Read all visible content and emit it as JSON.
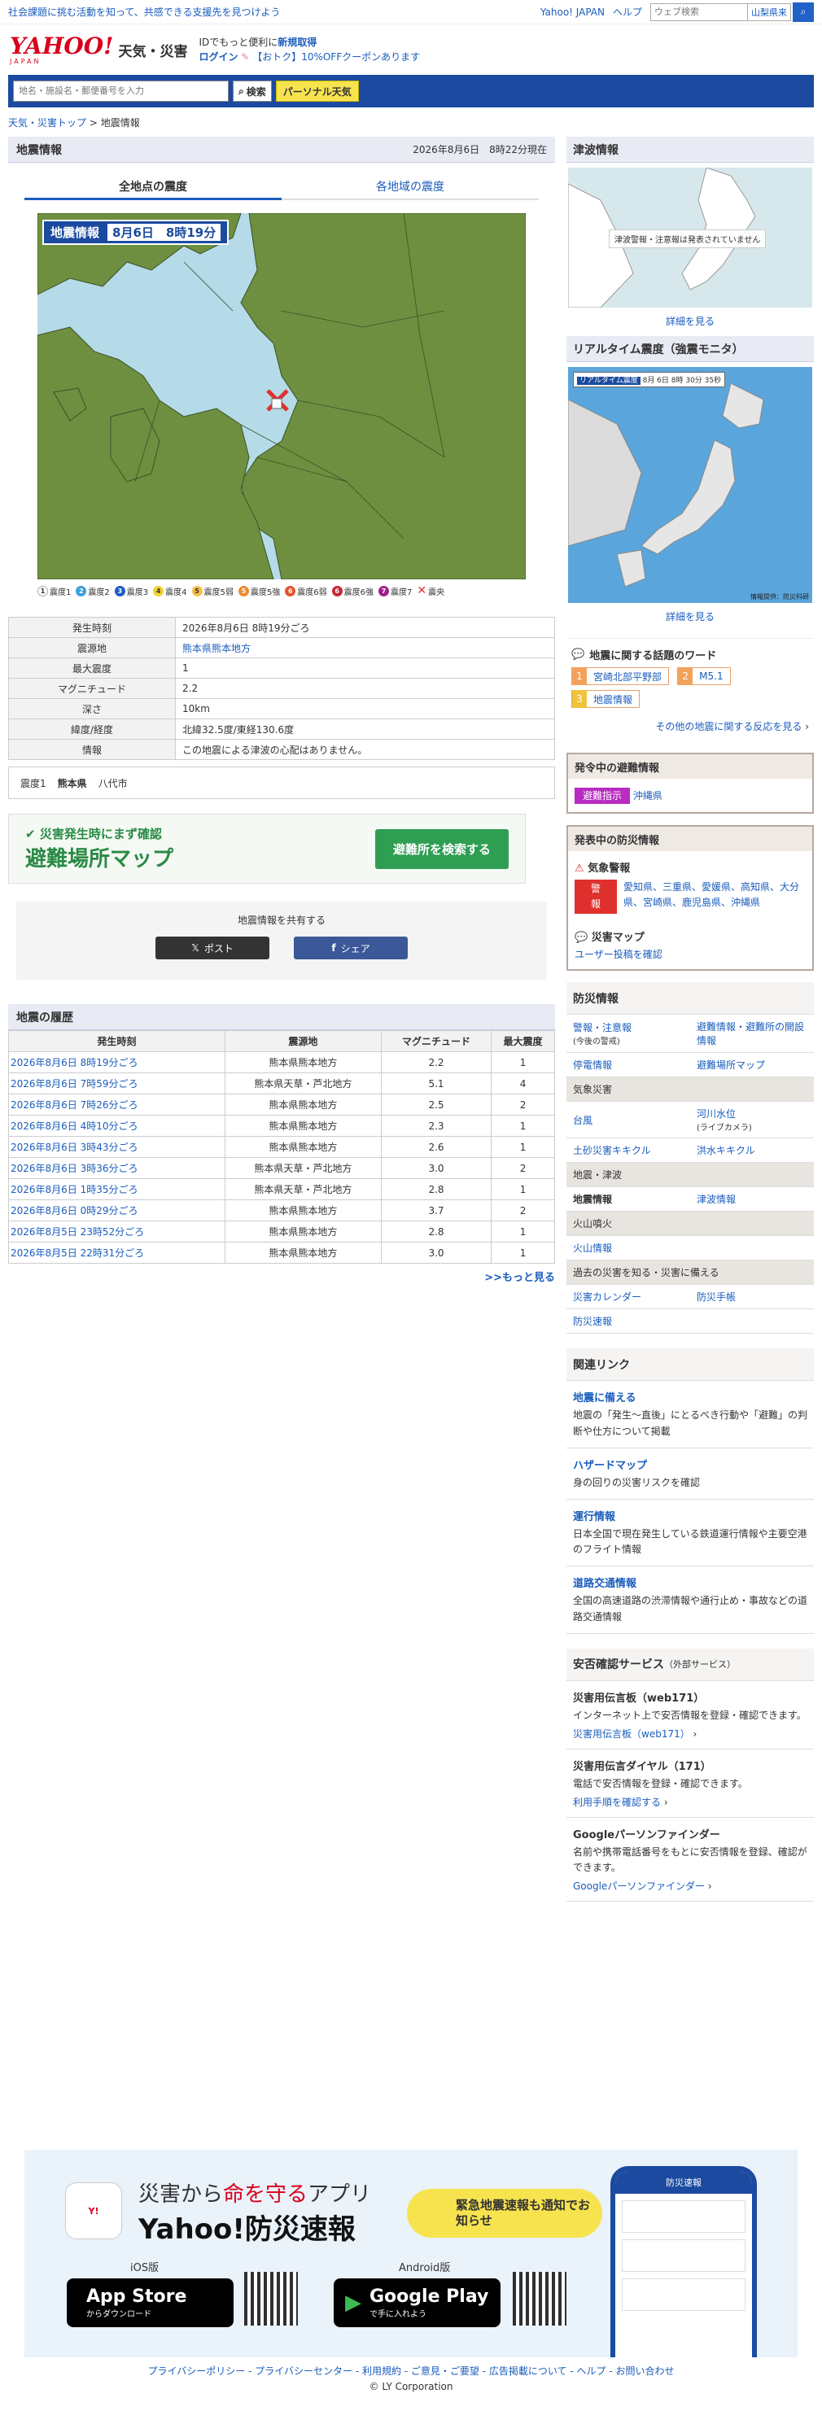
{
  "topbar": {
    "promo": "社会課題に挑む活動を知って、共感できる支援先を見つけよう",
    "links": [
      "Yahoo! JAPAN",
      "ヘルプ"
    ],
    "search_placeholder": "ウェブ検索",
    "location": "山梨県来"
  },
  "header": {
    "logo": "YAHOO!",
    "logo_sub": "JAPAN",
    "service": "天気・災害",
    "msg1": "IDでもっと便利に",
    "msg1_link": "新規取得",
    "login": "ログイン",
    "coupon": "【おトク】10%OFFクーポンあります"
  },
  "search": {
    "placeholder": "地名・施設名・郵便番号を入力",
    "button": "検索",
    "personal": "パーソナル天気"
  },
  "breadcrumb": [
    "天気・災害トップ",
    "地震情報"
  ],
  "quake": {
    "title": "地震情報",
    "asof": "2026年8月6日　8時22分現在",
    "tabs": [
      "全地点の震度",
      "各地域の震度"
    ],
    "map_title": "地震情報",
    "map_date": "8月6日　8時19分",
    "legend": [
      "震度1",
      "震度2",
      "震度3",
      "震度4",
      "震度5弱",
      "震度5強",
      "震度6弱",
      "震度6強",
      "震度7",
      "震央"
    ],
    "rows": [
      [
        "発生時刻",
        "2026年8月6日 8時19分ごろ"
      ],
      [
        "震源地",
        "熊本県熊本地方"
      ],
      [
        "最大震度",
        "1"
      ],
      [
        "マグニチュード",
        "2.2"
      ],
      [
        "深さ",
        "10km"
      ],
      [
        "緯度/経度",
        "北緯32.5度/東経130.6度"
      ],
      [
        "情報",
        "この地震による津波の心配はありません。"
      ]
    ],
    "shindo": {
      "level": "震度1",
      "pref": "熊本県",
      "city": "八代市"
    }
  },
  "banner": {
    "line1": "災害発生時にまず確認",
    "line2": "避難場所マップ",
    "button": "避難所を検索する"
  },
  "share": {
    "title": "地震情報を共有する",
    "post": "ポスト",
    "fb": "シェア"
  },
  "history": {
    "title": "地震の履歴",
    "headers": [
      "発生時刻",
      "震源地",
      "マグニチュード",
      "最大震度"
    ],
    "rows": [
      [
        "2026年8月6日 8時19分ごろ",
        "熊本県熊本地方",
        "2.2",
        "1"
      ],
      [
        "2026年8月6日 7時59分ごろ",
        "熊本県天草・芦北地方",
        "5.1",
        "4"
      ],
      [
        "2026年8月6日 7時26分ごろ",
        "熊本県熊本地方",
        "2.5",
        "2"
      ],
      [
        "2026年8月6日 4時10分ごろ",
        "熊本県熊本地方",
        "2.3",
        "1"
      ],
      [
        "2026年8月6日 3時43分ごろ",
        "熊本県熊本地方",
        "2.6",
        "1"
      ],
      [
        "2026年8月6日 3時36分ごろ",
        "熊本県天草・芦北地方",
        "3.0",
        "2"
      ],
      [
        "2026年8月6日 1時35分ごろ",
        "熊本県天草・芦北地方",
        "2.8",
        "1"
      ],
      [
        "2026年8月6日 0時29分ごろ",
        "熊本県熊本地方",
        "3.7",
        "2"
      ],
      [
        "2026年8月5日 23時52分ごろ",
        "熊本県熊本地方",
        "2.8",
        "1"
      ],
      [
        "2026年8月5日 22時31分ごろ",
        "熊本県熊本地方",
        "3.0",
        "1"
      ]
    ],
    "more": ">>もっと見る"
  },
  "side": {
    "tsunami": "津波情報",
    "tsunami_msg": "津波警報・注意報は発表されていません",
    "detail": "詳細を見る",
    "realtime": "リアルタイム震度（強震モニタ）",
    "realtime_label": "リアルタイム震度",
    "credit": "情報提供：防災科研",
    "words_title": "地震に関する話題のワード",
    "words": [
      "宮崎北部平野部",
      "M5.1",
      "地震情報"
    ],
    "words_more": "その他の地震に関する反応を見る",
    "evac_title": "発令中の避難情報",
    "evac_tag": "避難指示",
    "evac_pref": "沖縄県",
    "warn_title": "発表中の防災情報",
    "warn_head": "気象警報",
    "warn_tag": "警報",
    "warn_prefs": "愛知県、三重県、愛媛県、高知県、大分県、宮崎県、鹿児島県、沖縄県",
    "hazard_title": "災害マップ",
    "hazard_link": "ユーザー投稿を確認",
    "prev_title": "防災情報",
    "prev_rows": [
      [
        "l",
        "警報・注意報",
        "(今後の警戒)",
        "l",
        "避難情報・避難所の開設情報"
      ],
      [
        "l",
        "停電情報",
        "",
        "l",
        "避難場所マップ"
      ],
      [
        "c",
        "気象災害",
        "",
        "c",
        ""
      ],
      [
        "l",
        "台風",
        "",
        "l",
        "河川水位",
        "(ライブカメラ)"
      ],
      [
        "l",
        "土砂災害キキクル",
        "",
        "l",
        "洪水キキクル"
      ],
      [
        "c",
        "地震・津波",
        "",
        "c",
        ""
      ],
      [
        "b",
        "地震情報",
        "",
        "l",
        "津波情報"
      ],
      [
        "c",
        "火山噴火",
        "",
        "c",
        ""
      ],
      [
        "l",
        "火山情報",
        "",
        "l",
        ""
      ],
      [
        "c",
        "過去の災害を知る・災害に備える",
        "",
        "c",
        ""
      ],
      [
        "l",
        "災害カレンダー",
        "",
        "l",
        "防災手帳"
      ],
      [
        "l",
        "防災速報",
        "",
        "l",
        ""
      ]
    ],
    "links_title": "関連リンク",
    "links": [
      {
        "t": "地震に備える",
        "d": "地震の「発生〜直後」にとるべき行動や「避難」の判断や仕方について掲載"
      },
      {
        "t": "ハザードマップ",
        "d": "身の回りの災害リスクを確認"
      },
      {
        "t": "運行情報",
        "d": "日本全国で現在発生している鉄道運行情報や主要空港のフライト情報"
      },
      {
        "t": "道路交通情報",
        "d": "全国の高速道路の渋滞情報や通行止め・事故などの道路交通情報"
      }
    ],
    "safety_title": "安否確認サービス",
    "safety_sub": "（外部サービス）",
    "safety": [
      {
        "t": "災害用伝言板（web171）",
        "d": "インターネット上で安否情報を登録・確認できます。",
        "l": "災害用伝言板（web171）"
      },
      {
        "t": "災害用伝言ダイヤル（171）",
        "d": "電話で安否情報を登録・確認できます。",
        "l": "利用手順を確認する"
      },
      {
        "t": "Googleパーソンファインダー",
        "d": "名前や携帯電話番号をもとに安否情報を登録、確認ができます。",
        "l": "Googleパーソンファインダー"
      }
    ]
  },
  "app": {
    "pre": "災害から",
    "em": "命を守る",
    "post": "アプリ",
    "name": "Yahoo!防災速報",
    "bubble": "緊急地震速報も通知でお知らせ",
    "ios": "iOS版",
    "android": "Android版",
    "appstore_small": "",
    "appstore": "App Store",
    "appstore_sub": "からダウンロード",
    "gplay": "Google Play",
    "gplay_sub": "で手に入れよう",
    "phone_title": "防災速報"
  },
  "footer": {
    "links": "プライバシーポリシー - プライバシーセンター - 利用規約 - ご意見・ご要望 - 広告掲載について - ヘルプ - お問い合わせ",
    "copy": "© LY Corporation"
  },
  "colors": {
    "accent": "#1b4aa0",
    "link": "#1a5dbd",
    "land": "#6e8f3f",
    "sea": "#b5dbe9"
  }
}
